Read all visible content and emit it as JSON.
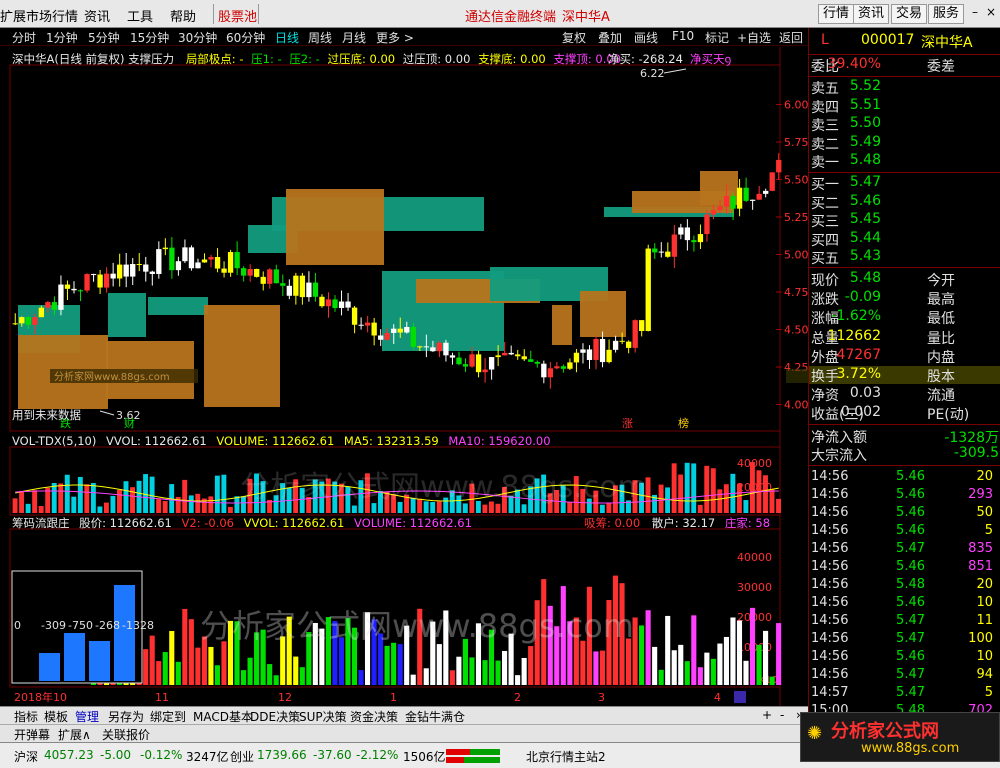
{
  "menu": {
    "items": [
      "扩展市场行情",
      "资讯",
      "工具",
      "帮助",
      "股票池"
    ],
    "center_title": "通达信金融终端",
    "center_stock": "深中华A",
    "right_buttons": [
      "行情",
      "资讯",
      "交易",
      "服务"
    ]
  },
  "periods": [
    "分时",
    "1分钟",
    "5分钟",
    "15分钟",
    "30分钟",
    "60分钟",
    "日线",
    "周线",
    "月线",
    "更多 >"
  ],
  "active_period": "日线",
  "toolbar": [
    "复权",
    "叠加",
    "画线",
    "F10",
    "标记",
    "+自选",
    "返回"
  ],
  "main_chart": {
    "header": {
      "title": "深中华A(日线 前复权) 支撑压力",
      "local_extreme": "局部极点: -",
      "press1": "压1: -",
      "press2": "压2: -",
      "cross_bottom": "过压底: 0.00",
      "cross_top": "过压顶: 0.00",
      "support_bottom": "支撑底: 0.00",
      "support_top": "支撑顶: 0.00",
      "net_buy": "净买: -268.24",
      "net_buy_tag": "净买天ꝯ"
    },
    "high_label": "6.22",
    "low_label": "3.62",
    "future_label": "用到未来数据",
    "markers": {
      "fall": "跌",
      "wealth": "财",
      "rise": "涨",
      "list": "榜"
    },
    "yaxis": [
      "6.00",
      "5.75",
      "5.50",
      "5.25",
      "5.00",
      "4.75",
      "4.50",
      "4.25",
      "4.00"
    ],
    "watermark_small": "分析家网www.88gs.com",
    "watermark_mid": "分析家公式网www.88gs.com"
  },
  "volume_chart": {
    "header": {
      "title": "VOL-TDX(5,10)",
      "vvol": "VVOL: 112662.61",
      "volume": "VOLUME: 112662.61",
      "ma5": "MA5: 132313.59",
      "ma10": "MA10: 159620.00"
    },
    "yaxis": [
      "40000",
      "20000"
    ]
  },
  "chip_chart": {
    "header": {
      "title": "筹码流跟庄",
      "price": "股价: 112662.61",
      "v2": "V2: -0.06",
      "vvol": "VVOL: 112662.61",
      "volume": "VOLUME: 112662.61",
      "absorb": "吸筹: 0.00",
      "retail": "散户: 32.17",
      "banker": "庄家: 58"
    },
    "yaxis": [
      "40000",
      "30000",
      "20000",
      "10000"
    ],
    "x10": "X10",
    "inset_values": [
      "0",
      "-309",
      "-750",
      "-268",
      "-1328"
    ],
    "watermark": "分析家公式网www.88gs.com"
  },
  "date_axis": [
    "2018年10",
    "11",
    "12",
    "1",
    "2",
    "3",
    "4"
  ],
  "tabs": [
    "指标",
    "模板",
    "管理",
    "另存为",
    "绑定到",
    "MACD基本",
    "DDE决策",
    "SUP决策",
    "资金决策",
    "金钻牛满仓"
  ],
  "active_tab": "管理",
  "tabs2": [
    "开弹幕",
    "扩展∧",
    "关联报价"
  ],
  "quote": {
    "flag": "L",
    "code": "000017",
    "name": "深中华A",
    "weibi_label": "委比",
    "weibi": "39.40%",
    "weicha_label": "委差",
    "sells": [
      {
        "label": "卖五",
        "price": "5.52"
      },
      {
        "label": "卖四",
        "price": "5.51"
      },
      {
        "label": "卖三",
        "price": "5.50"
      },
      {
        "label": "卖二",
        "price": "5.49"
      },
      {
        "label": "卖一",
        "price": "5.48"
      }
    ],
    "buys": [
      {
        "label": "买一",
        "price": "5.47"
      },
      {
        "label": "买二",
        "price": "5.46"
      },
      {
        "label": "买三",
        "price": "5.45"
      },
      {
        "label": "买四",
        "price": "5.44"
      },
      {
        "label": "买五",
        "price": "5.43"
      }
    ],
    "stats": [
      {
        "l1": "现价",
        "v1": "5.48",
        "l2": "今开"
      },
      {
        "l1": "涨跌",
        "v1": "-0.09",
        "l2": "最高"
      },
      {
        "l1": "涨幅",
        "v1": "-1.62%",
        "l2": "最低"
      },
      {
        "l1": "总量",
        "v1": "112662",
        "l2": "量比"
      },
      {
        "l1": "外盘",
        "v1": "47267",
        "l2": "内盘"
      },
      {
        "l1": "换手",
        "v1": "3.72%",
        "l2": "股本"
      },
      {
        "l1": "净资",
        "v1": "0.03",
        "l2": "流通"
      },
      {
        "l1": "收益(三)",
        "v1": "0.002",
        "l2": "PE(动)"
      }
    ],
    "net_inflow_label": "净流入额",
    "net_inflow": "-1328万",
    "block_inflow_label": "大宗流入",
    "block_inflow": "-309.5",
    "ticks": [
      {
        "time": "14:56",
        "price": "5.46",
        "vol": "20"
      },
      {
        "time": "14:56",
        "price": "5.46",
        "vol": "293"
      },
      {
        "time": "14:56",
        "price": "5.46",
        "vol": "50"
      },
      {
        "time": "14:56",
        "price": "5.46",
        "vol": "5"
      },
      {
        "time": "14:56",
        "price": "5.47",
        "vol": "835"
      },
      {
        "time": "14:56",
        "price": "5.46",
        "vol": "851"
      },
      {
        "time": "14:56",
        "price": "5.48",
        "vol": "20"
      },
      {
        "time": "14:56",
        "price": "5.46",
        "vol": "10"
      },
      {
        "time": "14:56",
        "price": "5.47",
        "vol": "11"
      },
      {
        "time": "14:56",
        "price": "5.47",
        "vol": "100"
      },
      {
        "time": "14:56",
        "price": "5.46",
        "vol": "10"
      },
      {
        "time": "14:56",
        "price": "5.47",
        "vol": "94"
      },
      {
        "time": "14:57",
        "price": "5.47",
        "vol": "5"
      },
      {
        "time": "15:00",
        "price": "5.48",
        "vol": "702"
      }
    ]
  },
  "status": {
    "sh_name": "沪深",
    "sh_val": "4057.23",
    "sh_chg": "-5.00",
    "sh_pct": "-0.12%",
    "sh_amt": "3247亿",
    "cy_name": "创业",
    "cy_val": "1739.66",
    "cy_chg": "-37.60",
    "cy_pct": "-2.12%",
    "cy_amt": "1506亿",
    "site": "北京行情主站2"
  },
  "logo": {
    "text": "分析家公式网",
    "url": "www.88gs.com"
  },
  "colors": {
    "up": "#ff3030",
    "down": "#00e0e0",
    "teal_box": "#139c80",
    "orange_box": "#b8741c",
    "yellow": "#ffff00",
    "green": "#00e000",
    "magenta": "#ff40ff"
  }
}
